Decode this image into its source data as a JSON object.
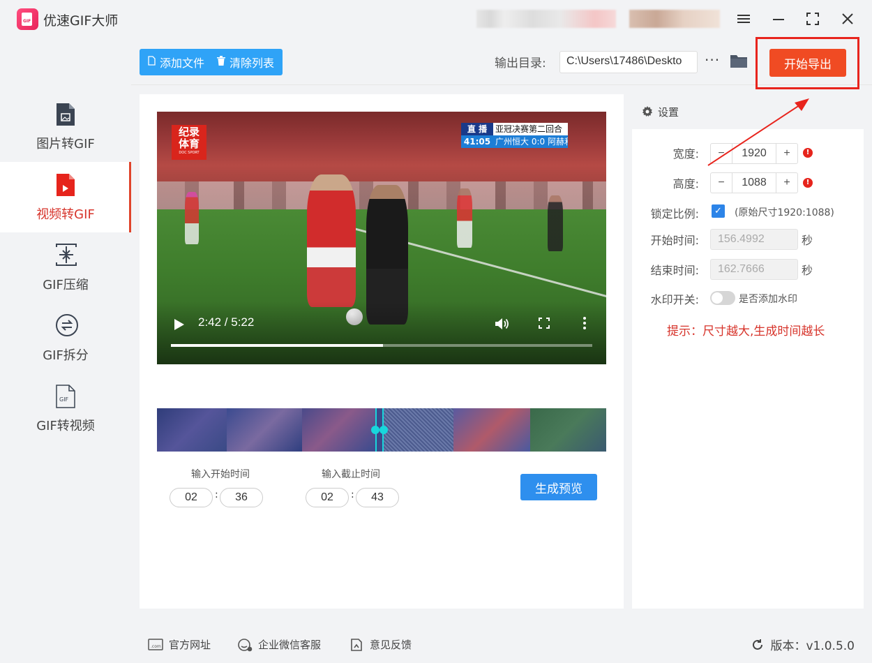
{
  "app": {
    "title": "优速GIF大师",
    "logo_text": "GIF"
  },
  "window_controls": [
    "menu-icon",
    "minimize-icon",
    "maximize-icon",
    "close-icon"
  ],
  "sidebar": {
    "items": [
      {
        "label": "图片转GIF",
        "icon": "image-file-icon",
        "active": false
      },
      {
        "label": "视频转GIF",
        "icon": "video-file-icon",
        "active": true
      },
      {
        "label": "GIF压缩",
        "icon": "compress-icon",
        "active": false
      },
      {
        "label": "GIF拆分",
        "icon": "split-icon",
        "active": false
      },
      {
        "label": "GIF转视频",
        "icon": "gif-file-icon",
        "active": false
      }
    ]
  },
  "toolbar": {
    "add_file": "添加文件",
    "clear_list": "清除列表",
    "output_label": "输出目录:",
    "output_path": "C:\\Users\\17486\\Deskto",
    "more": "···",
    "export": "开始导出"
  },
  "video": {
    "logo_line1": "纪录",
    "logo_line2": "体育",
    "logo_small": "DOC SPORT",
    "score_live": "直 播",
    "score_title": "亚冠决赛第二回合",
    "score_time": "41:05",
    "score_text": "广州恒大 0:0 阿赫利",
    "time_display": "2:42 / 5:22",
    "progress": 0.503
  },
  "trim": {
    "start_label": "输入开始时间",
    "end_label": "输入截止时间",
    "start_min": "02",
    "start_sec": "36",
    "end_min": "02",
    "end_sec": "43",
    "colon": ":",
    "preview_button": "生成预览"
  },
  "settings": {
    "header": "设置",
    "width_label": "宽度:",
    "width_value": "1920",
    "height_label": "高度:",
    "height_value": "1088",
    "minus": "−",
    "plus": "+",
    "warn": "!",
    "lock_label": "锁定比例:",
    "lock_checked": true,
    "original_size": "(原始尺寸1920:1088)",
    "start_label": "开始时间:",
    "start_value": "156.4992",
    "end_label": "结束时间:",
    "end_value": "162.7666",
    "unit": "秒",
    "watermark_label": "水印开关:",
    "watermark_on": false,
    "watermark_text": "是否添加水印",
    "tip": "提示：尺寸越大,生成时间越长"
  },
  "footer": {
    "website": "官方网址",
    "wechat": "企业微信客服",
    "feedback": "意见反馈",
    "version": "版本：v1.0.5.0"
  },
  "colors": {
    "accent_blue": "#2fa3f7",
    "export_red": "#f04b23",
    "highlight_red": "#e8241d",
    "active_red": "#d7342b",
    "timeline_cyan": "#18d6dc"
  }
}
